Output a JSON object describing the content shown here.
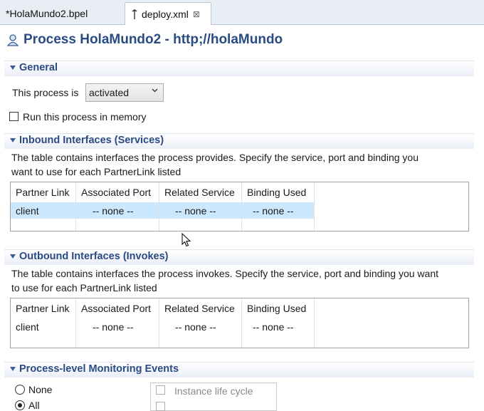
{
  "tabs": [
    {
      "label": "*HolaMundo2.bpel",
      "active": false
    },
    {
      "label": "deploy.xml",
      "active": true,
      "close": "⊠"
    }
  ],
  "page_title": "Process HolaMundo2 - http;//holaMundo",
  "sections": {
    "general": {
      "title": "General",
      "process_label": "This process is",
      "process_state": "activated",
      "run_in_memory_label": "Run this process in memory",
      "run_in_memory_checked": false
    },
    "inbound": {
      "title": "Inbound Interfaces (Services)",
      "description_line1": "The table contains interfaces the process provides.  Specify the service, port and binding you",
      "description_line2": "want to use for each PartnerLink listed",
      "columns": [
        "Partner Link",
        "Associated Port",
        "Related Service",
        "Binding Used"
      ],
      "rows": [
        {
          "partner_link": "client",
          "port": "-- none --",
          "service": "-- none --",
          "binding": "-- none --",
          "selected": true
        }
      ]
    },
    "outbound": {
      "title": "Outbound Interfaces (Invokes)",
      "description_line1": "The table contains interfaces the process invokes.  Specify the service, port and binding you want",
      "description_line2": "to use for each PartnerLink listed",
      "columns": [
        "Partner Link",
        "Associated Port",
        "Related Service",
        "Binding Used"
      ],
      "rows": [
        {
          "partner_link": "client",
          "port": "-- none --",
          "service": "-- none --",
          "binding": "-- none --",
          "selected": false
        }
      ]
    },
    "monitoring": {
      "title": "Process-level Monitoring Events",
      "radio_none": "None",
      "radio_all": "All",
      "instance_life_cycle": "Instance life cycle"
    }
  },
  "colors": {
    "title_blue": "#2a4b84",
    "selection": "#cce8ff",
    "tabbar_bg": "#e8edf4"
  },
  "icons": [
    "bpel-file-icon",
    "deploy-file-icon",
    "close-tab-icon",
    "process-icon",
    "chevron-down-icon",
    "mouse-cursor-icon"
  ]
}
